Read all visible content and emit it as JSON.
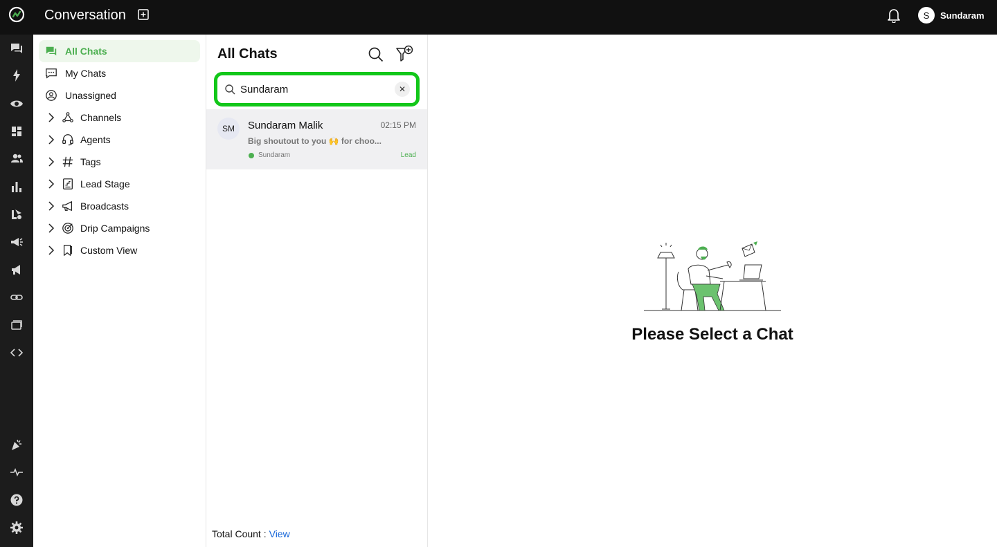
{
  "header": {
    "app_title": "Conversation",
    "user_initial": "S",
    "user_name": "Sundaram"
  },
  "rail": {
    "icons": [
      "chat-icon",
      "bolt-icon",
      "eye-icon",
      "dashboard-icon",
      "contacts-icon",
      "analytics-icon",
      "automation-icon",
      "campaign-icon",
      "broadcast-icon",
      "link-icon",
      "templates-icon",
      "code-icon",
      "celebrate-icon",
      "activity-icon",
      "help-icon",
      "settings-icon"
    ]
  },
  "nav": {
    "items": [
      {
        "label": "All Chats",
        "icon": "chats-icon",
        "active": true
      },
      {
        "label": "My Chats",
        "icon": "my-chats-icon"
      },
      {
        "label": "Unassigned",
        "icon": "unassigned-icon"
      },
      {
        "label": "Channels",
        "icon": "channels-icon"
      },
      {
        "label": "Agents",
        "icon": "headset-icon"
      },
      {
        "label": "Tags",
        "icon": "hash-icon"
      },
      {
        "label": "Lead Stage",
        "icon": "lead-stage-icon"
      },
      {
        "label": "Broadcasts",
        "icon": "megaphone-icon"
      },
      {
        "label": "Drip Campaigns",
        "icon": "target-icon"
      },
      {
        "label": "Custom View",
        "icon": "bookmark-icon"
      }
    ]
  },
  "chatlist": {
    "title": "All Chats",
    "search_value": "Sundaram",
    "chats": [
      {
        "initials": "SM",
        "name": "Sundaram Malik",
        "time": "02:15 PM",
        "preview": "Big shoutout to you 🙌 for choo...",
        "channel": "Sundaram",
        "badge": "Lead"
      }
    ],
    "total_label": "Total Count :",
    "total_link": "View"
  },
  "main": {
    "empty_title": "Please Select a Chat"
  },
  "colors": {
    "accent": "#4caf50",
    "highlight": "#12c719",
    "topbar": "#111111",
    "rail": "#1c1c1c",
    "link": "#1565d8"
  }
}
